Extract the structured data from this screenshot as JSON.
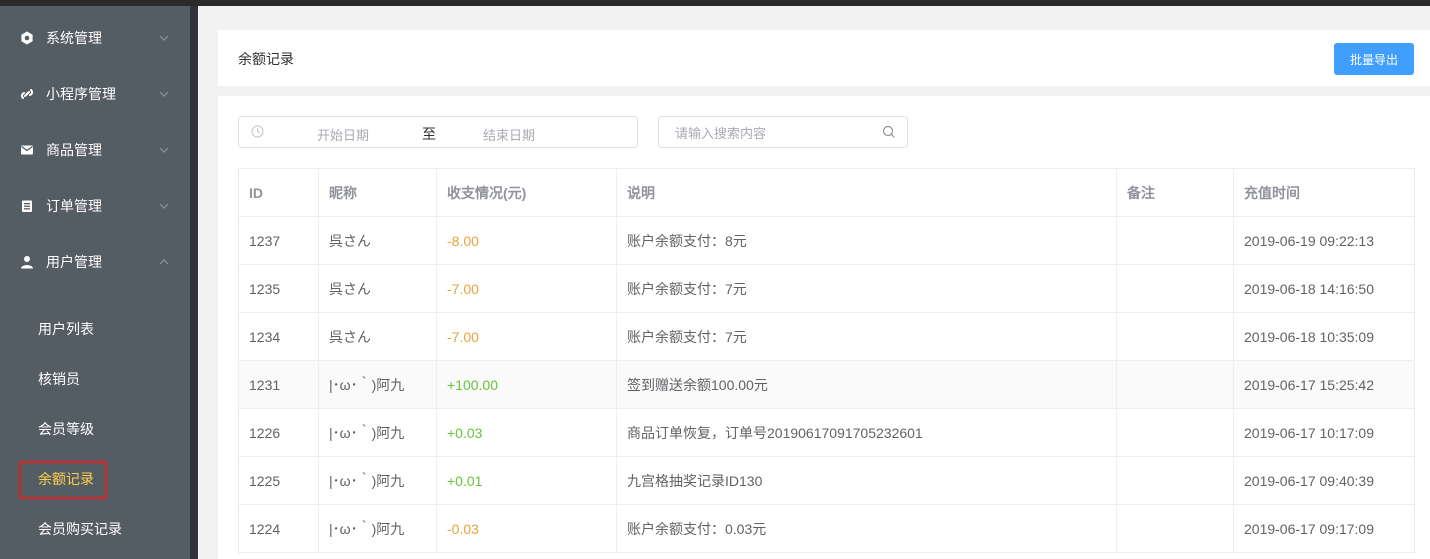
{
  "sidebar": {
    "menus": [
      {
        "label": "系统管理",
        "icon": "gear-icon",
        "expanded": false
      },
      {
        "label": "小程序管理",
        "icon": "link-icon",
        "expanded": false
      },
      {
        "label": "商品管理",
        "icon": "envelope-icon",
        "expanded": false
      },
      {
        "label": "订单管理",
        "icon": "clipboard-icon",
        "expanded": false
      },
      {
        "label": "用户管理",
        "icon": "user-icon",
        "expanded": true
      }
    ],
    "submenu": [
      {
        "label": "用户列表",
        "active": false
      },
      {
        "label": "核销员",
        "active": false
      },
      {
        "label": "会员等级",
        "active": false
      },
      {
        "label": "余额记录",
        "active": true
      },
      {
        "label": "会员购买记录",
        "active": false
      }
    ]
  },
  "header": {
    "title": "余额记录",
    "export_label": "批量导出"
  },
  "filters": {
    "start_placeholder": "开始日期",
    "range_separator": "至",
    "end_placeholder": "结束日期",
    "search_placeholder": "请输入搜索内容"
  },
  "table": {
    "columns": [
      "ID",
      "昵称",
      "收支情况(元)",
      "说明",
      "备注",
      "充值时间"
    ],
    "rows": [
      {
        "id": "1237",
        "nickname": "呉さん",
        "amount": "-8.00",
        "type": "neg",
        "desc": "账户余额支付：8元",
        "note": "",
        "time": "2019-06-19 09:22:13"
      },
      {
        "id": "1235",
        "nickname": "呉さん",
        "amount": "-7.00",
        "type": "neg",
        "desc": "账户余额支付：7元",
        "note": "",
        "time": "2019-06-18 14:16:50"
      },
      {
        "id": "1234",
        "nickname": "呉さん",
        "amount": "-7.00",
        "type": "neg",
        "desc": "账户余额支付：7元",
        "note": "",
        "time": "2019-06-18 10:35:09"
      },
      {
        "id": "1231",
        "nickname": "|･ω･｀)阿九",
        "amount": "+100.00",
        "type": "pos",
        "desc": "签到赠送余额100.00元",
        "note": "",
        "time": "2019-06-17 15:25:42"
      },
      {
        "id": "1226",
        "nickname": "|･ω･｀)阿九",
        "amount": "+0.03",
        "type": "pos",
        "desc": "商品订单恢复，订单号20190617091705232601",
        "note": "",
        "time": "2019-06-17 10:17:09"
      },
      {
        "id": "1225",
        "nickname": "|･ω･｀)阿九",
        "amount": "+0.01",
        "type": "pos",
        "desc": "九宫格抽奖记录ID130",
        "note": "",
        "time": "2019-06-17 09:40:39"
      },
      {
        "id": "1224",
        "nickname": "|･ω･｀)阿九",
        "amount": "-0.03",
        "type": "neg",
        "desc": "账户余额支付：0.03元",
        "note": "",
        "time": "2019-06-17 09:17:09"
      }
    ]
  },
  "colors": {
    "accent": "#409eff",
    "negative": "#e6a23c",
    "positive": "#67c23a",
    "active_menu": "#ffd04b",
    "sidebar_bg": "#545c64"
  }
}
